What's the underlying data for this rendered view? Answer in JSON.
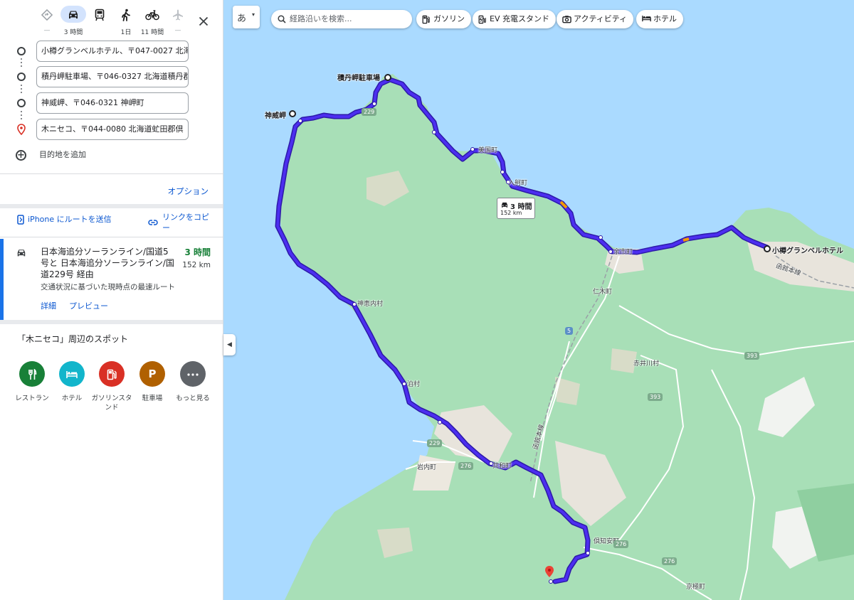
{
  "travel_modes": [
    {
      "name": "best",
      "label": "—"
    },
    {
      "name": "car",
      "label": "3 時間"
    },
    {
      "name": "transit",
      "label": ""
    },
    {
      "name": "walk",
      "label": "1日"
    },
    {
      "name": "bicycle",
      "label": "11 時間"
    },
    {
      "name": "flight",
      "label": "—"
    }
  ],
  "stops": [
    {
      "value": "小樽グランベルホテル、〒047-0027 北海"
    },
    {
      "value": "積丹岬駐車場、〒046-0327 北海道積丹郡"
    },
    {
      "value": "神威岬、〒046-0321 神岬町"
    },
    {
      "value": "木ニセコ、〒044-0080 北海道虻田郡倶"
    }
  ],
  "add_destination": "目的地を追加",
  "options_label": "オプション",
  "send_to_phone": "iPhone にルートを送信",
  "copy_link": "リンクをコピー",
  "route": {
    "name": "日本海追分ソーランライン/国道5号と 日本海追分ソーランライン/国道229号 経由",
    "time": "3 時間",
    "distance": "152 km",
    "description": "交通状況に基づいた現時点の最速ルート",
    "detail_label": "詳細",
    "preview_label": "プレビュー"
  },
  "spots": {
    "title": "「木ニセコ」周辺のスポット",
    "items": [
      {
        "label": "レストラン",
        "color": "#188038"
      },
      {
        "label": "ホテル",
        "color": "#12b5cb"
      },
      {
        "label": "ガソリンスタンド",
        "color": "#d93025"
      },
      {
        "label": "駐車場",
        "color": "#b06000"
      },
      {
        "label": "もっと見る",
        "color": "#5f6368"
      }
    ]
  },
  "map": {
    "ime_label": "あ",
    "search_placeholder": "経路沿いを検索...",
    "chips": [
      "ガソリン",
      "EV 充電スタンド",
      "アクティビティ",
      "ホテル"
    ],
    "route_time_box": {
      "time": "3 時間",
      "distance": "152 km"
    },
    "places": {
      "shakotan_parking": "積丹岬駐車場",
      "kamui": "神威岬",
      "otaru_hotel": "小樽グランベルホテル",
      "bikuni": "美国町",
      "irika": "入舸町",
      "furubira": "古平町",
      "yoichi": "余市町",
      "niki": "仁木町",
      "kamoenai": "神恵内村",
      "tomari": "泊村",
      "kyowa": "共和町",
      "iwanai": "岩内町",
      "akaigawa": "赤井川村",
      "kutchan": "倶知安町",
      "kyogoku": "京極町",
      "hakodate_line": "函館本線"
    },
    "shields": {
      "r229a": "229",
      "r229b": "229",
      "r5": "5",
      "r393a": "393",
      "r393b": "393",
      "r276a": "276",
      "r276b": "276",
      "r276c": "276"
    },
    "colors": {
      "sea": "#aadaff",
      "land": "#a7dfb6",
      "route": "#3b19d6",
      "water_text": "#3c4043"
    }
  }
}
